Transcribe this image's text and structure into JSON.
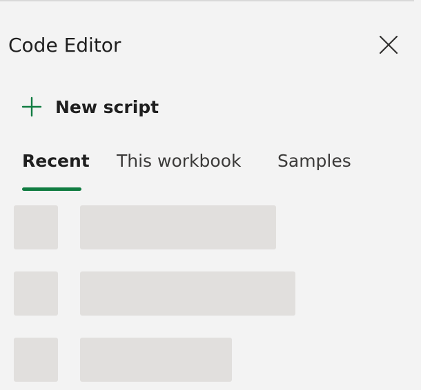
{
  "panel": {
    "title": "Code Editor",
    "close_icon": "close-icon"
  },
  "actions": {
    "new_script_label": "New script",
    "new_script_icon": "plus-icon",
    "accent_color": "#107c41"
  },
  "tabs": [
    {
      "label": "Recent",
      "active": true
    },
    {
      "label": "This workbook",
      "active": false
    },
    {
      "label": "Samples",
      "active": false
    }
  ],
  "loading_rows": 3,
  "colors": {
    "background": "#f3f3f3",
    "skeleton": "#e1dfdd"
  }
}
